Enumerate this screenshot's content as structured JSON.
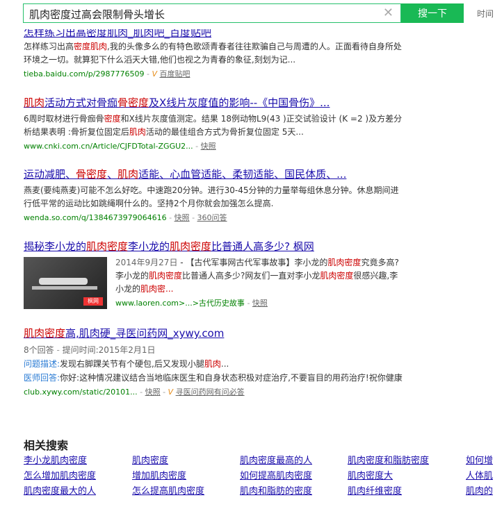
{
  "search": {
    "query": "肌肉密度过高会限制骨头增长",
    "button_label": "搜一下",
    "time_filter": "时间"
  },
  "results": [
    {
      "title_partial": "怎样练习出高密度肌肉_肌肉吧_百度贴吧",
      "snippet": [
        {
          "t": "怎样练习出高"
        },
        {
          "t": "密度肌肉",
          "h": true
        },
        {
          "t": ",我的头像多么的有特色歌颂青春者往往欺骗自己与周遭的人。正面看待自身所处环境之一切。就算犯下什么滔天大错,他们也视之为青春的象征,刻划为记..."
        }
      ],
      "url": "tieba.baidu.com/p/2987776509",
      "source": "百度贴吧"
    },
    {
      "title": [
        {
          "t": "肌肉",
          "h": true
        },
        {
          "t": "活动方式对骨痂"
        },
        {
          "t": "骨密度",
          "h": true
        },
        {
          "t": "及X线片灰度值的影响--《中国骨伤》..."
        }
      ],
      "snippet": [
        {
          "t": "6周时取材进行骨痂骨"
        },
        {
          "t": "密度",
          "h": true
        },
        {
          "t": "和X线片灰度值测定。结果 18例动物L9(43 )正交试验设计 (K =2 )及方差分析结果表明 :骨折复位固定后"
        },
        {
          "t": "肌肉",
          "h": true
        },
        {
          "t": "活动的最佳组合方式为骨折复位固定 5天..."
        }
      ],
      "url": "www.cnki.com.cn/Article/CJFDTotal-ZGGU2...",
      "snapshot": "快照"
    },
    {
      "title": [
        {
          "t": "运动减肥、"
        },
        {
          "t": "骨密度",
          "h": true
        },
        {
          "t": "、"
        },
        {
          "t": "肌肉",
          "h": true
        },
        {
          "t": "适能、心血管适能、柔韧适能、国民体质、..."
        }
      ],
      "snippet": [
        {
          "t": "燕麦(要纯燕麦)可能不怎么好吃。中速跑20分钟。进行30-45分钟的力量举每组休息分钟。休息期间进行低平常的运动比如跳绳啊什么的。坚持2个月你就会加强怎么提高."
        }
      ],
      "url": "wenda.so.com/q/1384673979064616",
      "snapshot": "快照",
      "extra": "360问答"
    },
    {
      "title": [
        {
          "t": "揭秘李小龙的"
        },
        {
          "t": "肌肉密度",
          "h": true
        },
        {
          "t": "李小龙的"
        },
        {
          "t": "肌肉密度",
          "h": true
        },
        {
          "t": "比普通人高多少? 枫网"
        }
      ],
      "date": "2014年9月27日",
      "snippet": [
        {
          "t": " - 【古代军事网古代军事故事】李小龙的"
        },
        {
          "t": "肌肉密度",
          "h": true
        },
        {
          "t": "究竟多高?李小龙的"
        },
        {
          "t": "肌肉密度",
          "h": true
        },
        {
          "t": "比普通人高多少?网友们一直对李小龙"
        },
        {
          "t": "肌肉密度",
          "h": true
        },
        {
          "t": "很感兴趣,李小龙的"
        },
        {
          "t": "肌肉密...",
          "h": true
        }
      ],
      "url": "www.laoren.com>...>古代历史故事",
      "snapshot": "快照"
    },
    {
      "title": [
        {
          "t": "肌肉密度",
          "h": true
        },
        {
          "t": "高,肌肉硬_寻医问药网_xywy.com"
        }
      ],
      "answers": "8个回答",
      "time": "提问时间:2015年2月1日",
      "question_label": "问题描述:",
      "question": [
        {
          "t": "发现右脚踝关节有个硬包,后又发现小腿"
        },
        {
          "t": "肌肉",
          "h": true
        },
        {
          "t": "..."
        }
      ],
      "answer_label": "医师回答:",
      "answer": "你好:这种情况建议结合当地临床医生和自身状态积极对症治疗,不要盲目的用药治疗!祝你健康",
      "url": "club.xywy.com/static/20101...",
      "snapshot": "快照",
      "source": "寻医问药网有问必答"
    }
  ],
  "related": {
    "title": "相关搜索",
    "items": [
      [
        "李小龙肌肉密度",
        "肌肉密度",
        "肌肉密度最高的人",
        "肌肉密度和脂肪密度",
        "如何增"
      ],
      [
        "怎么增加肌肉密度",
        "增加肌肉密度",
        "如何提高肌肉密度",
        "肌肉密度大",
        "人体肌"
      ],
      [
        "肌肉密度最大的人",
        "怎么提高肌肉密度",
        "肌肉和脂肪的密度",
        "肌肉纤维密度",
        "肌肉的"
      ]
    ]
  },
  "thumb_logo": "枫网"
}
